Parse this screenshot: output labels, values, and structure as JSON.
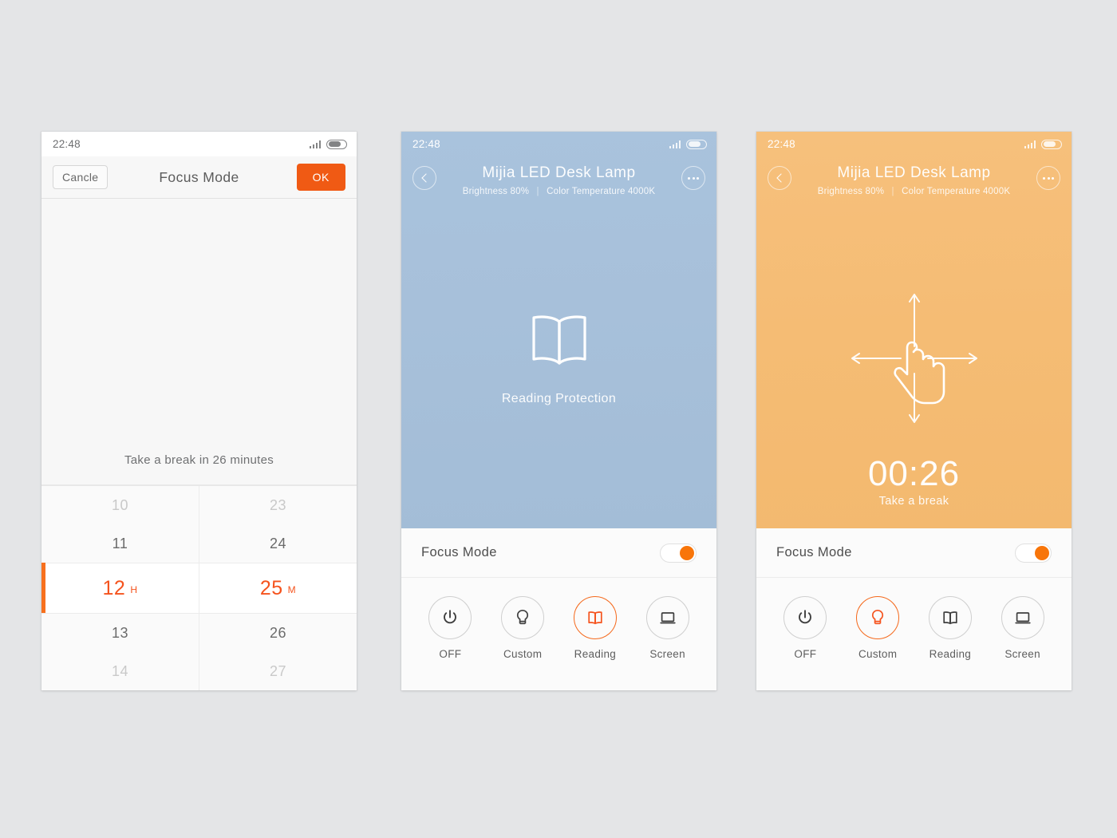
{
  "statusbar": {
    "time": "22:48",
    "signal_icon": "signal-bars-icon",
    "battery_icon": "battery-icon"
  },
  "screen1": {
    "cancel_label": "Cancle",
    "title": "Focus Mode",
    "ok_label": "OK",
    "hint": "Take a break in 26 minutes",
    "picker": {
      "hours": {
        "far_above": "10",
        "near_above": "11",
        "selected": "12",
        "unit": "H",
        "near_below": "13",
        "far_below": "14"
      },
      "minutes": {
        "far_above": "23",
        "near_above": "24",
        "selected": "25",
        "unit": "M",
        "near_below": "26",
        "far_below": "27"
      }
    }
  },
  "screen2": {
    "back_icon": "chevron-left-icon",
    "menu_icon": "more-dots-icon",
    "title": "Mijia LED Desk Lamp",
    "brightness": "Brightness 80%",
    "separator": "|",
    "color_temperature": "Color Temperature 4000K",
    "hero_icon": "open-book-icon",
    "hero_caption": "Reading Protection",
    "focus_label": "Focus Mode",
    "toggle_state": "on",
    "modes": [
      {
        "label": "OFF",
        "icon": "power-icon",
        "active": false
      },
      {
        "label": "Custom",
        "icon": "lightbulb-icon",
        "active": false
      },
      {
        "label": "Reading",
        "icon": "open-book-icon",
        "active": true
      },
      {
        "label": "Screen",
        "icon": "monitor-icon",
        "active": false
      }
    ]
  },
  "screen3": {
    "back_icon": "chevron-left-icon",
    "menu_icon": "more-dots-icon",
    "title": "Mijia LED Desk Lamp",
    "brightness": "Brightness 80%",
    "separator": "|",
    "color_temperature": "Color Temperature 4000K",
    "hero_icon": "hand-gesture-swipe-icon",
    "countdown": "00:26",
    "countdown_label": "Take a break",
    "focus_label": "Focus Mode",
    "toggle_state": "on",
    "modes": [
      {
        "label": "OFF",
        "icon": "power-icon",
        "active": false
      },
      {
        "label": "Custom",
        "icon": "lightbulb-icon",
        "active": true
      },
      {
        "label": "Reading",
        "icon": "open-book-icon",
        "active": false
      },
      {
        "label": "Screen",
        "icon": "monitor-icon",
        "active": false
      }
    ]
  },
  "colors": {
    "accent_orange": "#f5531d",
    "toggle_orange": "#f87509",
    "ok_button": "#f05a14",
    "hero_blue": "#a7c0da",
    "hero_orange": "#f5bc74",
    "page_background": "#e4e5e7"
  }
}
